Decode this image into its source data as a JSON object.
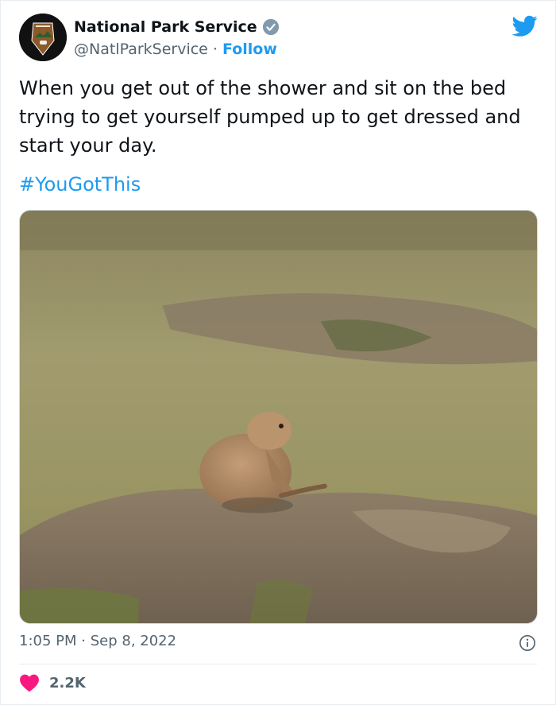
{
  "author": {
    "display_name": "National Park Service",
    "handle": "@NatlParkService",
    "separator": "·",
    "follow_label": "Follow"
  },
  "tweet": {
    "text": "When you get out of the shower and sit on the bed trying to get yourself pumped up to get dressed and start your day.",
    "hashtag": "#YouGotThis"
  },
  "media": {
    "icon": "prairie-dog-photo"
  },
  "meta": {
    "time": "1:05 PM",
    "separator": "·",
    "date": "Sep 8, 2022"
  },
  "engagement": {
    "likes": "2.2K"
  },
  "colors": {
    "accent": "#1d9bf0",
    "heart": "#f91880",
    "secondary_text": "#536471"
  }
}
